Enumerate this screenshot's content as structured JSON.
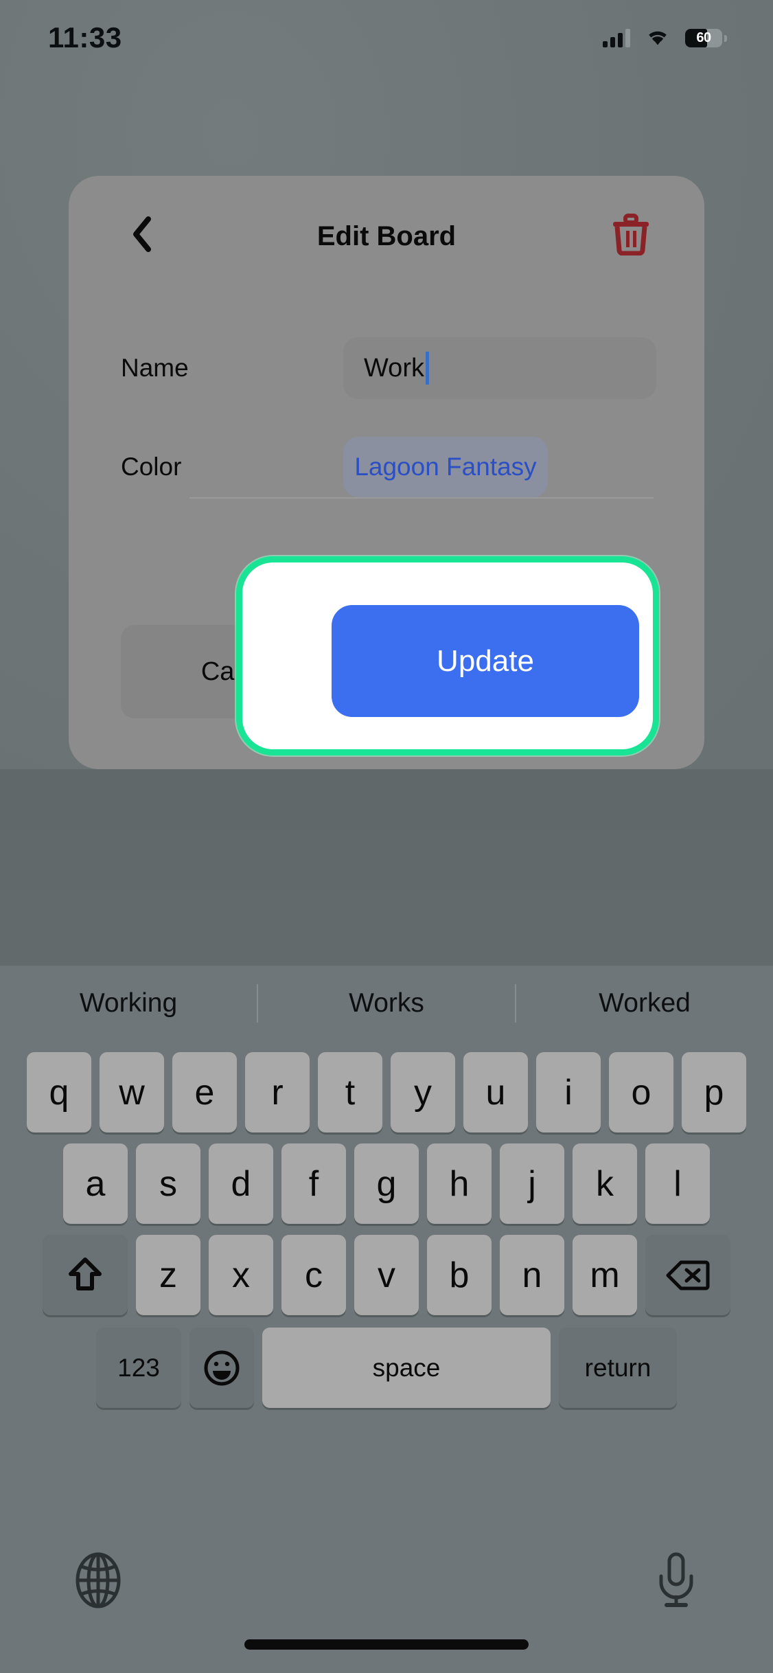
{
  "status_bar": {
    "time": "11:33",
    "signal_icon": "cellular-bars-icon",
    "wifi_icon": "wifi-icon",
    "battery_level": "60",
    "battery_icon": "battery-icon"
  },
  "modal": {
    "title": "Edit Board",
    "back_icon": "chevron-left-icon",
    "delete_icon": "trash-icon",
    "delete_color": "#8b2227",
    "fields": [
      {
        "label": "Name",
        "value": "Work",
        "type": "text-input"
      },
      {
        "label": "Color",
        "value": "Lagoon Fantasy",
        "type": "color-chip",
        "value_color": "#2b4fc4"
      }
    ],
    "buttons": {
      "cancel": "Cancel",
      "update": "Update",
      "update_color": "#3b6ff0",
      "highlight_color": "#19e394"
    }
  },
  "keyboard": {
    "suggestions": [
      "Working",
      "Works",
      "Worked"
    ],
    "row1": [
      "q",
      "w",
      "e",
      "r",
      "t",
      "y",
      "u",
      "i",
      "o",
      "p"
    ],
    "row2": [
      "a",
      "s",
      "d",
      "f",
      "g",
      "h",
      "j",
      "k",
      "l"
    ],
    "row3_letters": [
      "z",
      "x",
      "c",
      "v",
      "b",
      "n",
      "m"
    ],
    "shift_icon": "shift-arrow-icon",
    "backspace_icon": "backspace-icon",
    "numbers_key": "123",
    "emoji_icon": "emoji-smiley-icon",
    "space_key": "space",
    "return_key": "return",
    "globe_icon": "globe-icon",
    "mic_icon": "microphone-icon"
  }
}
